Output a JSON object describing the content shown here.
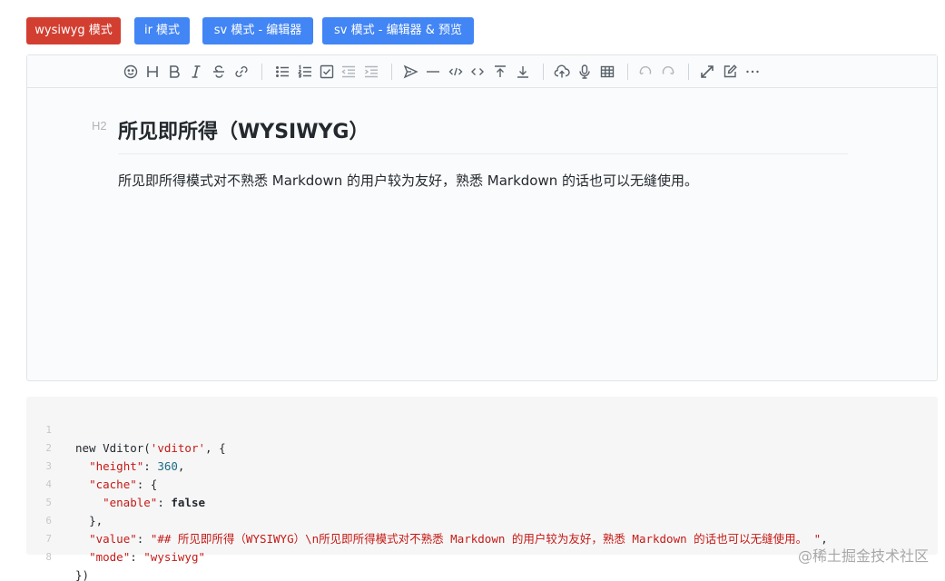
{
  "mode_buttons": {
    "wysiwyg": "wysiwyg 模式",
    "ir": "ir 模式",
    "sv": "sv 模式 - 编辑器",
    "sv_preview": "sv 模式 - 编辑器 & 预览"
  },
  "colors": {
    "active_mode": "#d23f31",
    "inactive_mode": "#4285f4"
  },
  "toolbar_icons": [
    "emoji-icon",
    "headings-icon",
    "bold-icon",
    "italic-icon",
    "strike-icon",
    "link-icon",
    "list-icon",
    "ordered-list-icon",
    "check-icon",
    "outdent-icon",
    "indent-icon",
    "quote-icon",
    "line-icon",
    "code-icon",
    "inline-code-icon",
    "insert-before-icon",
    "insert-after-icon",
    "upload-icon",
    "record-icon",
    "table-icon",
    "undo-icon",
    "redo-icon",
    "fullscreen-icon",
    "edit-mode-icon",
    "more-icon"
  ],
  "editor": {
    "heading_marker": "H2",
    "heading": "所见即所得（WYSIWYG）",
    "paragraph": "所见即所得模式对不熟悉 Markdown 的用户较为友好，熟悉 Markdown 的话也可以无缝使用。"
  },
  "code": {
    "line_numbers": [
      "1",
      "2",
      "3",
      "4",
      "5",
      "6",
      "7",
      "8"
    ],
    "l1": {
      "a": "new Vditor(",
      "b": "'vditor'",
      "c": ", {"
    },
    "l2": {
      "key": "\"height\"",
      "sep": ": ",
      "val": "360",
      "end": ","
    },
    "l3": {
      "key": "\"cache\"",
      "sep": ": {"
    },
    "l4": {
      "key": "\"enable\"",
      "sep": ": ",
      "val": "false"
    },
    "l5": {
      "text": "},"
    },
    "l6": {
      "key": "\"value\"",
      "sep": ": ",
      "val": "\"## 所见即所得（WYSIWYG）\\n所见即所得模式对不熟悉 Markdown 的用户较为友好，熟悉 Markdown 的话也可以无缝使用。 \"",
      "end": ","
    },
    "l7": {
      "key": "\"mode\"",
      "sep": ": ",
      "val": "\"wysiwyg\""
    },
    "l8": {
      "text": "})"
    }
  },
  "watermark": "@稀土掘金技术社区"
}
